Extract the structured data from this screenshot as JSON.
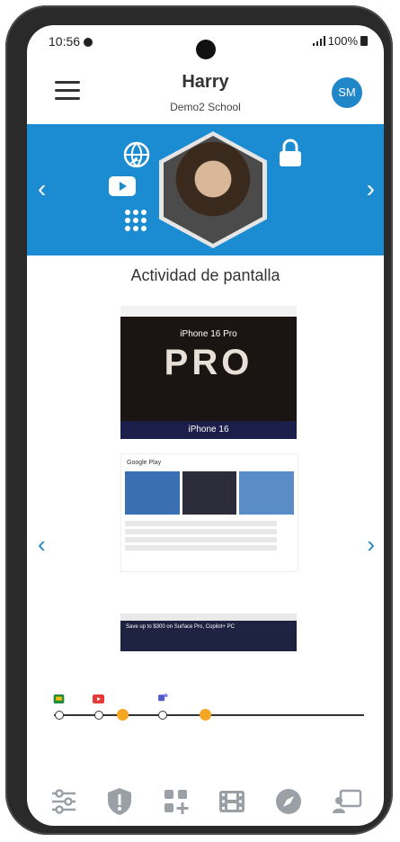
{
  "status_bar": {
    "time": "10:56",
    "battery": "100%"
  },
  "header": {
    "title": "Harry",
    "subtitle": "Demo2 School",
    "avatar_initials": "SM",
    "accent_color": "#1f86c8"
  },
  "banner": {
    "background_color": "#1b8bd2",
    "left_arrow": "‹",
    "right_arrow": "›",
    "icons": [
      "globe-cursor-icon",
      "lock-icon",
      "youtube-icon",
      "apps-grid-icon"
    ]
  },
  "section": {
    "title": "Actividad de pantalla"
  },
  "screenshots": {
    "shot1_heading": "iPhone 16 Pro",
    "shot1_big": "PRO",
    "shot1_footer": "iPhone 16",
    "shot2_title": "Google Play",
    "shot3_text": "Save up to $300 on Surface Pro, Copilot+ PC",
    "left_arrow": "‹",
    "right_arrow": "›"
  },
  "timeline": {
    "apps": [
      "google-classroom-icon",
      "youtube-icon",
      "teams-icon"
    ]
  },
  "bottom_nav": [
    {
      "name": "filters-icon"
    },
    {
      "name": "shield-alert-icon"
    },
    {
      "name": "add-apps-icon"
    },
    {
      "name": "film-icon"
    },
    {
      "name": "compass-icon"
    },
    {
      "name": "presentation-icon"
    }
  ]
}
